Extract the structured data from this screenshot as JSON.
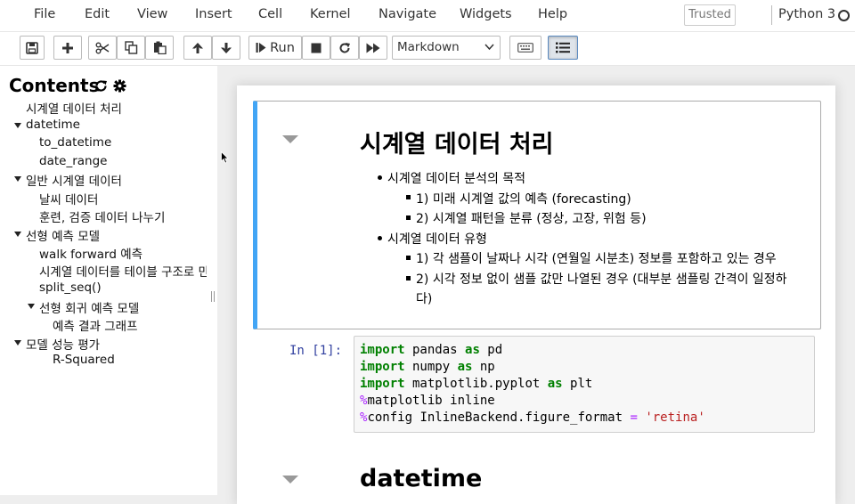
{
  "menubar": {
    "items": [
      "File",
      "Edit",
      "View",
      "Insert",
      "Cell",
      "Kernel",
      "Navigate",
      "Widgets",
      "Help"
    ],
    "trusted_label": "Trusted",
    "kernel_name": "Python 3"
  },
  "toolbar": {
    "run_label": "Run",
    "cell_type": "Markdown",
    "icons": [
      "save-icon",
      "plus-icon",
      "scissors-icon",
      "copy-icon",
      "paste-icon",
      "arrow-up-icon",
      "arrow-down-icon",
      "step-forward-icon",
      "stop-icon",
      "refresh-icon",
      "fast-forward-icon",
      "keyboard-icon",
      "list-icon"
    ]
  },
  "toc": {
    "title": "Contents",
    "items": [
      {
        "label": "시계열 데이터 처리",
        "level": 1,
        "expandable": false
      },
      {
        "label": "datetime",
        "level": 1,
        "expandable": true
      },
      {
        "label": "to_datetime",
        "level": 2,
        "expandable": false
      },
      {
        "label": "date_range",
        "level": 2,
        "expandable": false
      },
      {
        "label": "일반 시계열 데이터",
        "level": 1,
        "expandable": true
      },
      {
        "label": "날씨 데이터",
        "level": 2,
        "expandable": false
      },
      {
        "label": "훈련, 검증 데이터 나누기",
        "level": 2,
        "expandable": false
      },
      {
        "label": "선형 예측 모델",
        "level": 1,
        "expandable": true
      },
      {
        "label": "walk forward 예측",
        "level": 2,
        "expandable": false
      },
      {
        "label": "시계열 데이터를 테이블 구조로 만",
        "level": 2,
        "expandable": false
      },
      {
        "label": "split_seq()",
        "level": 2,
        "expandable": false
      },
      {
        "label": "선형 회귀 예측 모델",
        "level": 2,
        "expandable": true
      },
      {
        "label": "예측 결과 그래프",
        "level": 3,
        "expandable": false
      },
      {
        "label": "모델 성능 평가",
        "level": 1,
        "expandable": true
      },
      {
        "label": "R-Squared",
        "level": 3,
        "expandable": false
      }
    ]
  },
  "markdown_cell": {
    "heading": "시계열 데이터 처리",
    "list": [
      {
        "text": "시계열 데이터 분석의 목적",
        "level": 1
      },
      {
        "text": "1) 미래 시계열 값의 예측 (forecasting)",
        "level": 2
      },
      {
        "text": "2) 시계열 패턴을 분류 (정상, 고장, 위험 등)",
        "level": 2
      },
      {
        "text": "시계열 데이터 유형",
        "level": 1
      },
      {
        "text": "1) 각 샘플이 날짜나 시각 (연월일 시분초) 정보를 포함하고 있는 경우",
        "level": 2
      },
      {
        "text": "2) 시각 정보 없이 샘플 값만 나열된 경우 (대부분 샘플링 간격이 일정하",
        "level": 2
      },
      {
        "text": "다)",
        "level": 2,
        "continuation": true
      }
    ]
  },
  "code_cell": {
    "prompt": "In [1]:",
    "lines": [
      "import pandas as pd",
      "import numpy as np",
      "import matplotlib.pyplot as plt",
      "%matplotlib inline",
      "%config InlineBackend.figure_format = 'retina'"
    ]
  },
  "next_cell": {
    "heading": "datetime"
  },
  "colors": {
    "selected_cell_border": "#42a5f5",
    "prompt_color": "#303f9f",
    "keyword_green": "#008000",
    "magic_purple": "#aa22ff",
    "string_red": "#ba2121"
  }
}
